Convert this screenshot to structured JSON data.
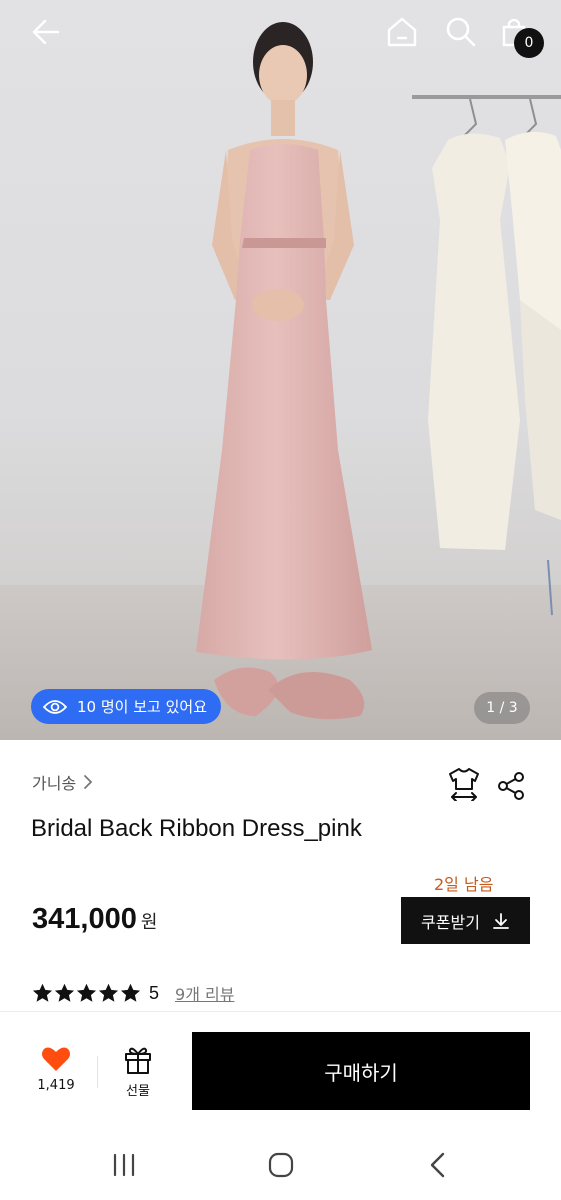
{
  "header": {
    "icons": [
      "back-arrow-icon",
      "home-icon",
      "search-icon",
      "shopping-bag-icon"
    ],
    "cart_count": "0"
  },
  "gallery": {
    "viewers_text": "10 명이 보고 있어요",
    "page_indicator": "1 / 3",
    "current_page": 1,
    "total_pages": 3
  },
  "product": {
    "brand": "가니송",
    "title": "Bridal Back Ribbon Dress_pink",
    "coupon_deadline": "2일 남음",
    "price": "341,000",
    "currency": "원",
    "coupon_button": "쿠폰받기",
    "rating": {
      "stars": 5,
      "score": "5",
      "reviews_link": "9개 리뷰"
    }
  },
  "actions": {
    "like_count": "1,419",
    "gift_label": "선물",
    "buy_label": "구매하기",
    "like_color": "#ff4d10"
  },
  "colors": {
    "viewer_badge": "#2f6cf4",
    "deadline_text": "#c75b1c",
    "primary_button": "#000000"
  }
}
